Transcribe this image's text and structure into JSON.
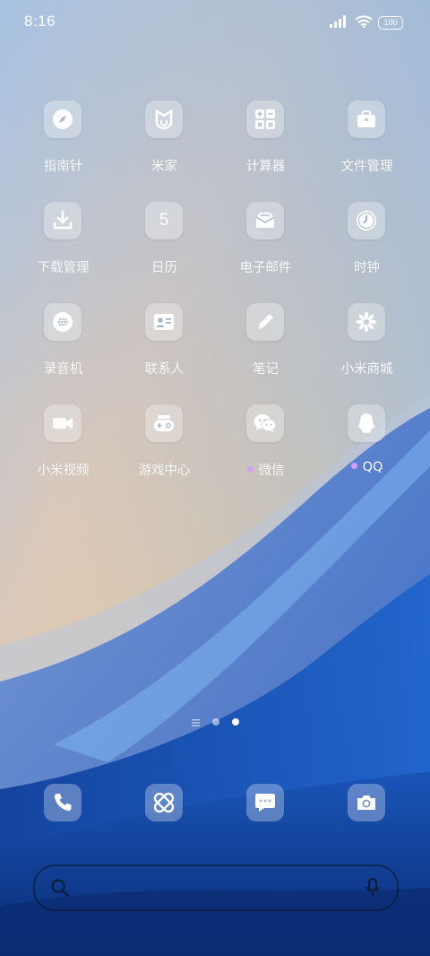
{
  "status_bar": {
    "time": "8:16",
    "battery": "100",
    "icons": [
      "signal-icon",
      "wifi-icon",
      "battery-icon"
    ]
  },
  "apps": [
    {
      "label": "指南针",
      "icon": "compass-icon"
    },
    {
      "label": "米家",
      "icon": "mijia-icon"
    },
    {
      "label": "计算器",
      "icon": "calculator-icon"
    },
    {
      "label": "文件管理",
      "icon": "briefcase-icon"
    },
    {
      "label": "下载管理",
      "icon": "download-icon"
    },
    {
      "label": "日历",
      "icon": "calendar-icon",
      "icon_text": "5"
    },
    {
      "label": "电子邮件",
      "icon": "mail-icon"
    },
    {
      "label": "时钟",
      "icon": "clock-icon"
    },
    {
      "label": "录音机",
      "icon": "recorder-icon"
    },
    {
      "label": "联系人",
      "icon": "contacts-icon"
    },
    {
      "label": "笔记",
      "icon": "pen-icon"
    },
    {
      "label": "小米商城",
      "icon": "mi-store-icon"
    },
    {
      "label": "小米视频",
      "icon": "video-icon"
    },
    {
      "label": "游戏中心",
      "icon": "gamepad-icon"
    },
    {
      "label": "微信",
      "icon": "wechat-icon",
      "new_dot": true
    },
    {
      "label": "QQ",
      "icon": "qq-icon",
      "new_dot": true
    }
  ],
  "page_indicator": {
    "pages": 2,
    "current": 2
  },
  "dock": [
    {
      "icon": "phone-icon"
    },
    {
      "icon": "browser-icon"
    },
    {
      "icon": "messages-icon"
    },
    {
      "icon": "camera-icon"
    }
  ],
  "search_bar": {
    "icons": [
      "search-icon",
      "microphone-icon"
    ]
  },
  "colors": {
    "new_dot": "#d49cf5",
    "wave_blue": "#1e5fc4",
    "dark_blue": "#0a2f7a"
  }
}
